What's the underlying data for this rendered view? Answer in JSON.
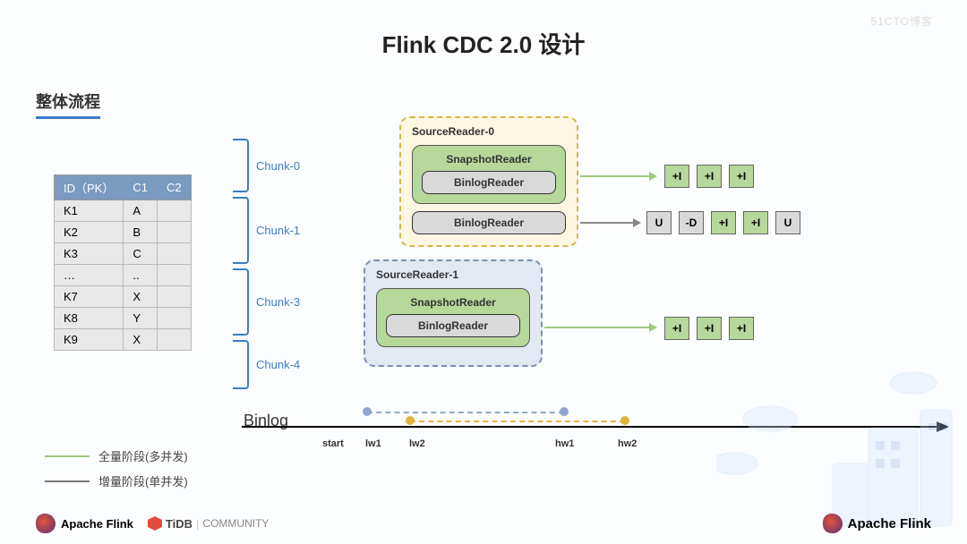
{
  "title": "Flink CDC 2.0 设计",
  "section": "整体流程",
  "table": {
    "headers": [
      "ID（PK）",
      "C1",
      "C2"
    ],
    "rows": [
      [
        "K1",
        "A",
        ""
      ],
      [
        "K2",
        "B",
        ""
      ],
      [
        "K3",
        "C",
        ""
      ],
      [
        "…",
        "..",
        ""
      ],
      [
        "K7",
        "X",
        ""
      ],
      [
        "K8",
        "Y",
        ""
      ],
      [
        "K9",
        "X",
        ""
      ]
    ]
  },
  "chunks": [
    "Chunk-0",
    "Chunk-1",
    "Chunk-3",
    "Chunk-4"
  ],
  "readers": {
    "r0": {
      "title": "SourceReader-0",
      "snapshot": "SnapshotReader",
      "binlog_inner": "BinlogReader",
      "binlog_outer": "BinlogReader"
    },
    "r1": {
      "title": "SourceReader-1",
      "snapshot": "SnapshotReader",
      "binlog_inner": "BinlogReader"
    }
  },
  "events": {
    "row1": [
      "+I",
      "+I",
      "+I"
    ],
    "row2": [
      "U",
      "-D",
      "+I",
      "+I",
      "U"
    ],
    "row3": [
      "+I",
      "+I",
      "+I"
    ]
  },
  "binlog": {
    "label": "Binlog",
    "ticks": [
      "start",
      "lw1",
      "lw2",
      "hw1",
      "hw2"
    ]
  },
  "legend": {
    "full": "全量阶段(多并发)",
    "incr": "增量阶段(单并发)"
  },
  "footer": {
    "flink": "Apache Flink",
    "tidb": "TiDB",
    "community": "COMMUNITY"
  },
  "watermark": "51CTO博客"
}
